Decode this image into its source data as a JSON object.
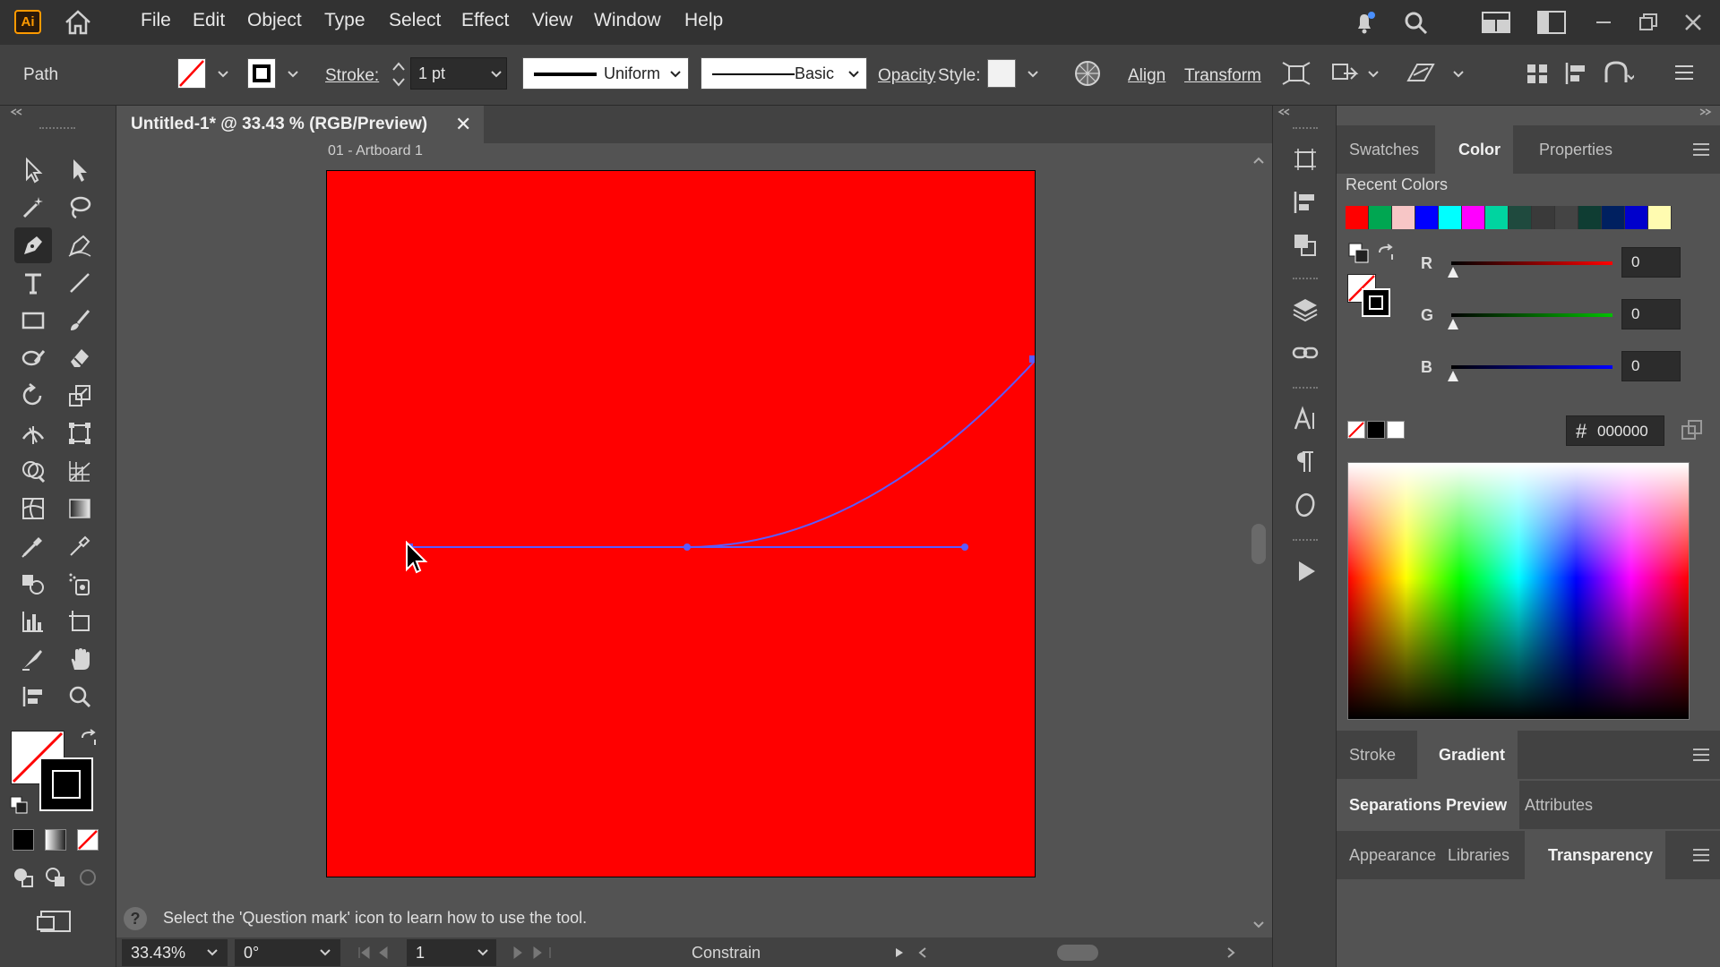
{
  "app": {
    "logo_text": "Ai"
  },
  "menu": {
    "items": [
      "File",
      "Edit",
      "Object",
      "Type",
      "Select",
      "Effect",
      "View",
      "Window",
      "Help"
    ]
  },
  "controlbar": {
    "selection_label": "Path",
    "stroke_label": "Stroke:",
    "stroke_weight": "1 pt",
    "profile_label": "Uniform",
    "brush_label": "Basic",
    "opacity_label": "Opacity",
    "style_label": "Style:",
    "align_label": "Align",
    "transform_label": "Transform"
  },
  "document": {
    "tab_title": "Untitled-1* @ 33.43 % (RGB/Preview)",
    "close_glyph": "✕",
    "artboard_label": "01 - Artboard 1",
    "artboard_color": "#ff0000"
  },
  "status": {
    "help_glyph": "?",
    "help_text": "Select the 'Question mark' icon to learn how to use the tool.",
    "zoom": "33.43%",
    "rotation": "0°",
    "artboard_number": "1",
    "mode": "Constrain"
  },
  "panels": {
    "top_tabs": [
      "Swatches",
      "Color",
      "Properties"
    ],
    "active_top_tab": "Color",
    "recent_colors_label": "Recent Colors",
    "recent_colors": [
      "#ff0000",
      "#00a651",
      "#f7c6c6",
      "#0000ff",
      "#00ffff",
      "#ff00ff",
      "#00d4a0",
      "#1f4a3e",
      "#3a3a3a",
      "#444444",
      "#0f3d33",
      "#002060",
      "#0000cc",
      "#fffbb0"
    ],
    "rgb": {
      "r_label": "R",
      "g_label": "G",
      "b_label": "B",
      "r": "0",
      "g": "0",
      "b": "0"
    },
    "hex_symbol": "#",
    "hex_value": "000000",
    "stroke_gradient_tabs": [
      "Stroke",
      "Gradient"
    ],
    "sep_tabs": [
      "Separations Preview",
      "Attributes"
    ],
    "appearance_tabs": [
      "Appearance",
      "Libraries",
      "Transparency"
    ]
  }
}
